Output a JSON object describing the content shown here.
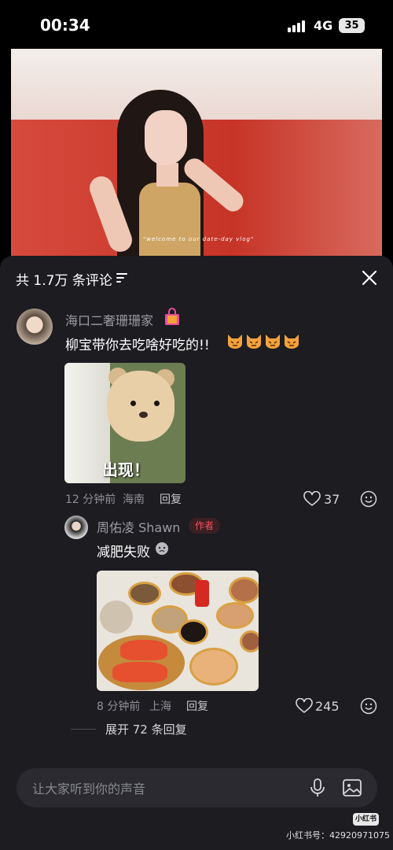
{
  "status_bar": {
    "time": "00:34",
    "network": "4G",
    "battery": "35"
  },
  "video": {
    "overlay_text": "\"welcome to our date-day vlog\""
  },
  "panel": {
    "header": "共 1.7万 条评论"
  },
  "comments": [
    {
      "username": "海口二奢珊珊家",
      "text": "柳宝带你去吃啥好吃的!!",
      "sticker_text": "出现！",
      "time": "12 分钟前",
      "location": "海南",
      "reply_label": "回复",
      "likes": "37"
    }
  ],
  "reply": {
    "username": "周佑凌 Shawn",
    "badge": "作者",
    "text": "减肥失败",
    "time": "8 分钟前",
    "location": "上海",
    "reply_label": "回复",
    "likes": "245"
  },
  "expand_label": "展开 72 条回复",
  "input": {
    "placeholder": "让大家听到你的声音"
  },
  "watermark": {
    "logo": "小红书",
    "id": "小红书号：42920971075"
  },
  "colors": {
    "panel_bg": "#1c1c21",
    "author_badge": "#ff4d5a"
  }
}
